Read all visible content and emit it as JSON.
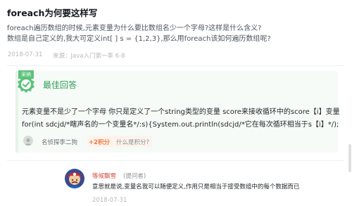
{
  "question": {
    "title": "foreach为何要这样写",
    "body_line1": "foreach遍历数组的时候,元素变量为什么要比数组名少一个字母?这样是什么含义?",
    "body_line2": "数组是自己定义的,我大可定义int[ ] s = {1,2,3},那么用foreach该如何遍历数组呢?",
    "date": "2018-07-31",
    "source": "来源：Java入门第一季 6-8"
  },
  "best_answer": {
    "tag": "采纳",
    "label": "最佳回答",
    "line1": "元素变量不是少了一个字母    你只是定义了一个string类型的变量 score来接收循环中的score【i】变量",
    "line2": "for(int sdcjd/*瞎声名的一个变量名*/:s){System.out.println(sdcjd/*它在每次循环相当于s【i】*/);",
    "answerer": "名侦探李二狗",
    "points": "+2积分",
    "points_question": "什么是积分?"
  },
  "reply": {
    "name": "等候飘雪",
    "role": "(提问者)",
    "text": "意思就是说,变量名我可以随便定义,作用只是相当于接受数组中的每个数据而已",
    "date": "2018-07-31"
  },
  "colors": {
    "accent_green": "#2e9e55",
    "badge_green": "#5dc27a",
    "answer_bg": "#f6fbf7",
    "points_orange": "#f07b3f",
    "reply_name_red": "#d34a3b"
  }
}
